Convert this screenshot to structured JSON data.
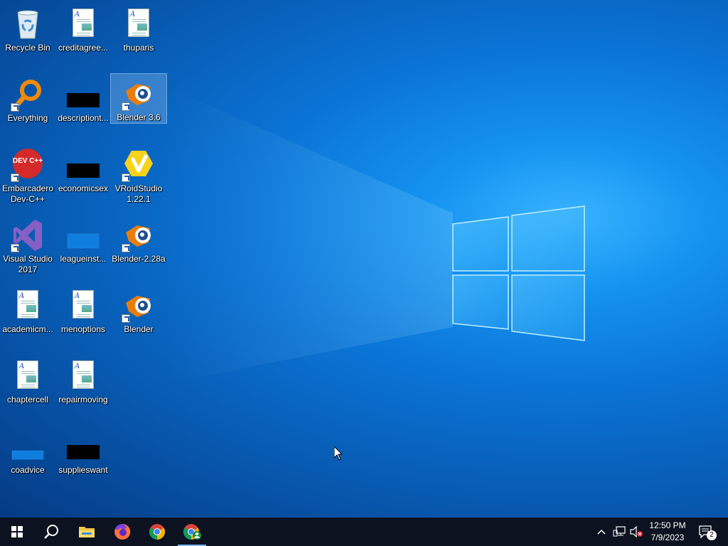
{
  "desktop": {
    "icons": [
      {
        "label": "Recycle Bin"
      },
      {
        "label": "creditagree..."
      },
      {
        "label": "thuparis"
      },
      {
        "label": "Everything"
      },
      {
        "label": "descriptiont..."
      },
      {
        "label": "Blender 3.6"
      },
      {
        "label": "Embarcadero Dev-C++"
      },
      {
        "label": "economicsex"
      },
      {
        "label": "VRoidStudio 1.22.1"
      },
      {
        "label": "Visual Studio 2017"
      },
      {
        "label": "leagueinst..."
      },
      {
        "label": "Blender-2.28a"
      },
      {
        "label": "academicm..."
      },
      {
        "label": "menoptions"
      },
      {
        "label": "Blender"
      },
      {
        "label": "chaptercell"
      },
      {
        "label": "repairmoving"
      },
      {
        "label": "coadvice"
      },
      {
        "label": "supplieswant"
      }
    ],
    "selected_icon": "Blender 3.6",
    "devcpp_logo_text": "DEV C++"
  },
  "taskbar": {
    "buttons": [
      "start-icon",
      "search-icon",
      "file-explorer-icon",
      "firefox-icon",
      "chrome-icon",
      "chrome-profile-icon"
    ],
    "active_button": "chrome-profile-icon",
    "tray_icons": [
      "chevron-up-icon",
      "network-icon",
      "volume-muted-icon"
    ],
    "clock_time": "12:50 PM",
    "clock_date": "7/9/2023",
    "notification_count": "2"
  },
  "colors": {
    "wallpaper": "#0a74d6",
    "taskbar": "#0c1220",
    "blender_orange": "#e87d0d",
    "vs_purple": "#865fc5",
    "devcpp_red": "#d42a2a",
    "vroid_yellow": "#f6d31a"
  }
}
